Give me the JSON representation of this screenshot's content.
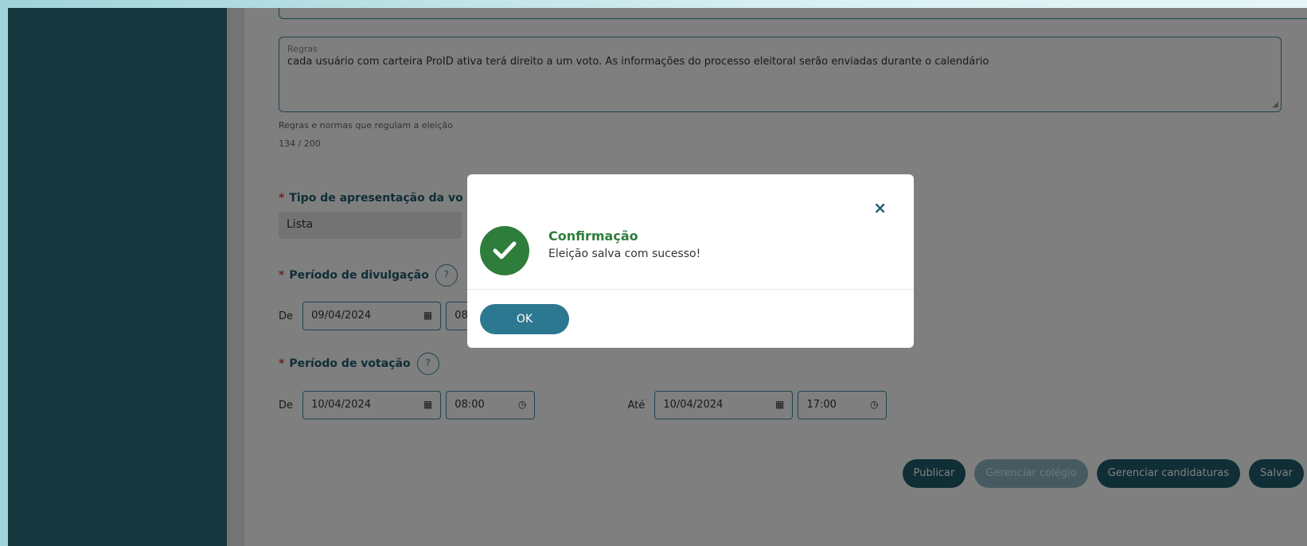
{
  "form": {
    "rules_label": "Regras",
    "rules_value": "cada usuário com carteira ProID ativa terá direito a um voto. As informações do processo eleitoral serão enviadas durante o calendário",
    "rules_hint": "Regras e normas que regulam a eleição",
    "rules_counter": "134 / 200",
    "vote_type_label": "Tipo de apresentação da vo",
    "vote_type_value": "Lista",
    "publicity_label": "Período de divulgação",
    "publicity_from": "De",
    "publicity_start_date": "09/04/2024",
    "publicity_start_time": "08",
    "voting_label": "Período de votação",
    "voting_from": "De",
    "voting_start_date": "10/04/2024",
    "voting_start_time": "08:00",
    "voting_to": "Até",
    "voting_end_date": "10/04/2024",
    "voting_end_time": "17:00",
    "help": "?",
    "required_mark": "*"
  },
  "actions": {
    "publish": "Publicar",
    "manage_college": "Gerenciar colégio",
    "manage_candidacies": "Gerenciar candidaturas",
    "save": "Salvar"
  },
  "modal": {
    "title": "Confirmação",
    "message": "Eleição salva com sucesso!",
    "ok": "OK",
    "close": "×"
  },
  "icons": {
    "success": "check-circle-icon",
    "calendar": "calendar-icon",
    "clock": "clock-icon"
  },
  "colors": {
    "primary": "#1f5d6d",
    "success": "#2e7d3b",
    "sidebar": "#2c6c7c",
    "required": "#e0413a"
  }
}
